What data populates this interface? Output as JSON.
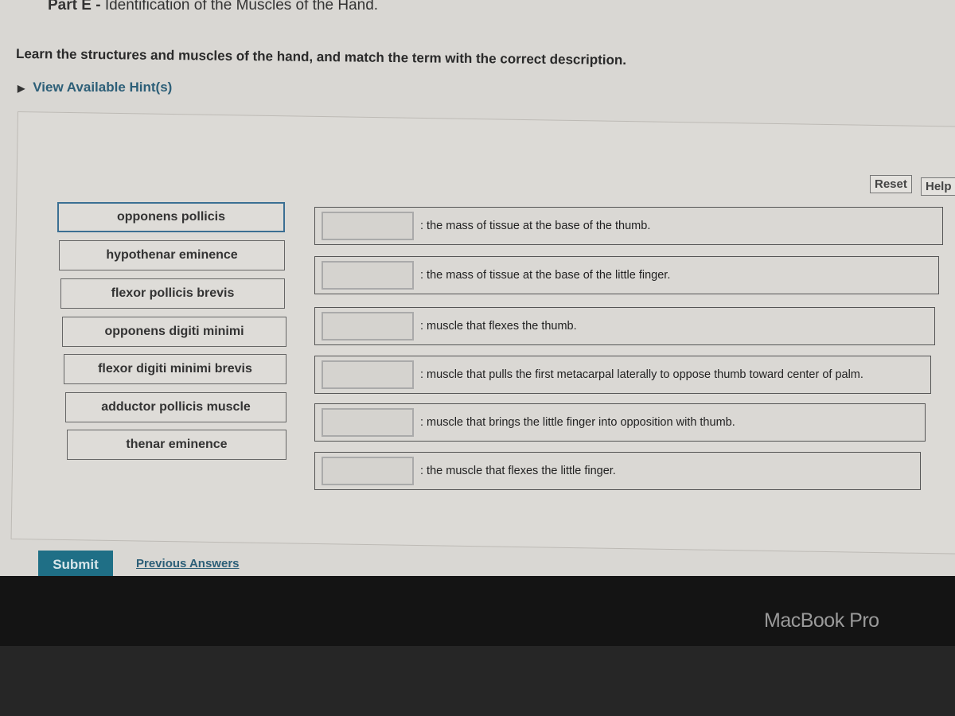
{
  "header": {
    "part_label": "Part E -",
    "title": "Identification of the Muscles of the Hand.",
    "instructions": "Learn the structures and muscles of the hand, and match the term with the correct description.",
    "hint_link": "View Available Hint(s)"
  },
  "toolbar": {
    "reset_label": "Reset",
    "help_label": "Help"
  },
  "terms": [
    "opponens pollicis",
    "hypothenar eminence",
    "flexor pollicis brevis",
    "opponens digiti minimi",
    "flexor digiti minimi brevis",
    "adductor pollicis muscle",
    "thenar eminence"
  ],
  "descriptions": [
    ": the mass of tissue at the base of the thumb.",
    ": the mass of tissue at the base of the little finger.",
    ": muscle that flexes the thumb.",
    ": muscle that pulls the first metacarpal laterally to oppose thumb toward center of palm.",
    ": muscle that brings the little finger into opposition with thumb.",
    ": the muscle that flexes the little finger."
  ],
  "footer": {
    "submit_label": "Submit",
    "previous_answers_label": "Previous Answers"
  },
  "bezel": {
    "brand": "MacBook Pro"
  },
  "colors": {
    "accent": "#1f6f86",
    "link": "#2d5f78"
  }
}
